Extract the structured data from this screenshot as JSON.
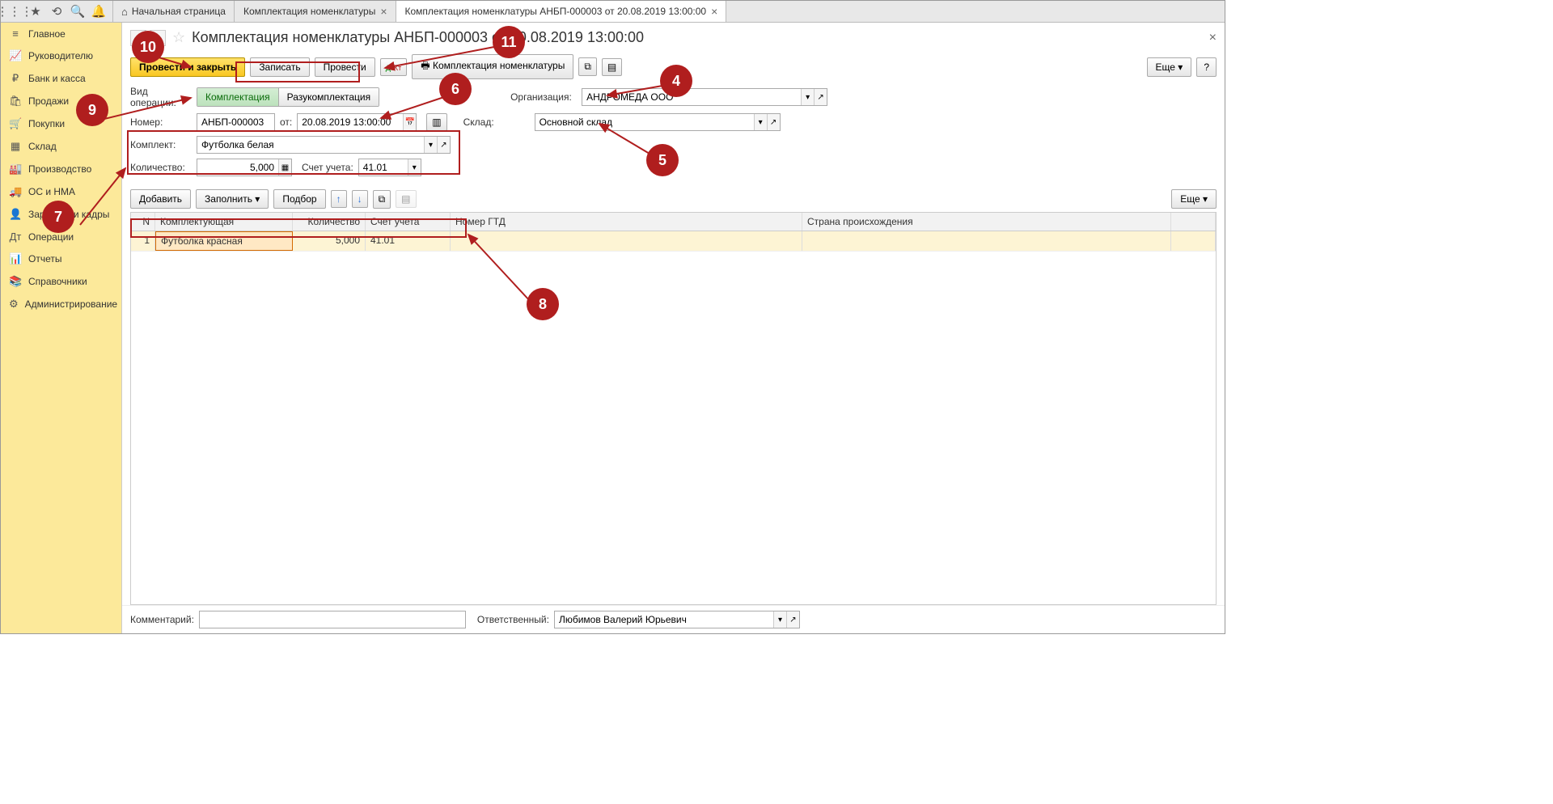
{
  "tabs": {
    "home": "Начальная страница",
    "list": "Комплектация номенклатуры",
    "doc": "Комплектация номенклатуры АНБП-000003 от 20.08.2019 13:00:00"
  },
  "sidebar": {
    "items": [
      {
        "icon": "≡",
        "label": "Главное"
      },
      {
        "icon": "📈",
        "label": "Руководителю"
      },
      {
        "icon": "₽",
        "label": "Банк и касса"
      },
      {
        "icon": "🛍",
        "label": "Продажи"
      },
      {
        "icon": "🛒",
        "label": "Покупки"
      },
      {
        "icon": "▦",
        "label": "Склад"
      },
      {
        "icon": "🏭",
        "label": "Производство"
      },
      {
        "icon": "🚚",
        "label": "ОС и НМА"
      },
      {
        "icon": "👤",
        "label": "Зарплата и кадры"
      },
      {
        "icon": "Дт",
        "label": "Операции"
      },
      {
        "icon": "📊",
        "label": "Отчеты"
      },
      {
        "icon": "📚",
        "label": "Справочники"
      },
      {
        "icon": "⚙",
        "label": "Администрирование"
      }
    ]
  },
  "title": "Комплектация номенклатуры АНБП-000003 от 20.08.2019 13:00:00",
  "cmdbar": {
    "post_close": "Провести и закрыть",
    "write": "Записать",
    "post": "Провести",
    "print": "Комплектация номенклатуры",
    "more": "Еще"
  },
  "form": {
    "optype_label": "Вид операции:",
    "optype_kit": "Комплектация",
    "optype_unkit": "Разукомплектация",
    "org_label": "Организация:",
    "org_value": "АНДРОМЕДА ООО",
    "num_label": "Номер:",
    "num_value": "АНБП-000003",
    "date_prefix": "от:",
    "date_value": "20.08.2019 13:00:00",
    "whs_label": "Склад:",
    "whs_value": "Основной склад",
    "kit_label": "Комплект:",
    "kit_value": "Футболка белая",
    "qty_label": "Количество:",
    "qty_value": "5,000",
    "acct_label": "Счет учета:",
    "acct_value": "41.01"
  },
  "tbl_toolbar": {
    "add": "Добавить",
    "fill": "Заполнить",
    "pick": "Подбор",
    "more": "Еще"
  },
  "table": {
    "cols": {
      "n": "N",
      "comp": "Комплектующая",
      "qty": "Количество",
      "acct": "Счет учета",
      "gtd": "Номер ГТД",
      "cntry": "Страна происхождения"
    },
    "rows": [
      {
        "n": "1",
        "comp": "Футболка красная",
        "qty": "5,000",
        "acct": "41.01",
        "gtd": "",
        "cntry": ""
      }
    ]
  },
  "bottom": {
    "comment_label": "Комментарий:",
    "comment_value": "",
    "resp_label": "Ответственный:",
    "resp_value": "Любимов Валерий Юрьевич"
  },
  "callouts": {
    "c4": "4",
    "c5": "5",
    "c6": "6",
    "c7": "7",
    "c8": "8",
    "c9": "9",
    "c10": "10",
    "c11": "11"
  }
}
